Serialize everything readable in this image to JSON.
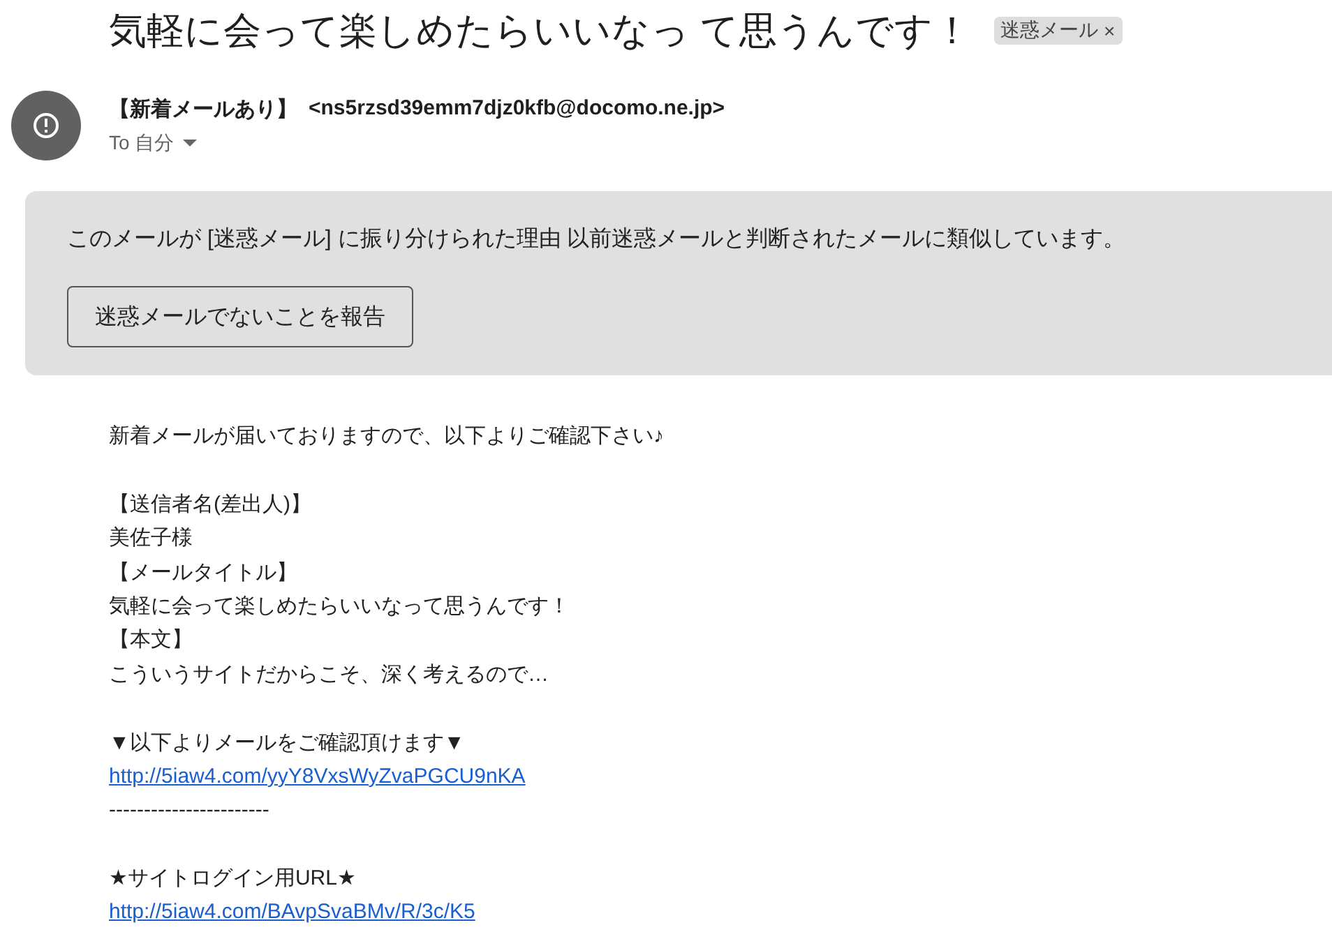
{
  "subject": "気軽に会って楽しめたらいいなっ て思うんです！",
  "label": {
    "text": "迷惑メール",
    "close": "×"
  },
  "sender": {
    "name": "【新着メールあり】",
    "address": "<ns5rzsd39emm7djz0kfb@docomo.ne.jp>",
    "recipient": "To 自分"
  },
  "spam_banner": {
    "message": "このメールが [迷惑メール] に振り分けられた理由 以前迷惑メールと判断されたメールに類似しています。",
    "button": "迷惑メールでないことを報告"
  },
  "body": [
    {
      "kind": "text",
      "text": "新着メールが届いておりますので、以下よりご確認下さい♪"
    },
    {
      "kind": "blank"
    },
    {
      "kind": "text",
      "text": "【送信者名(差出人)】"
    },
    {
      "kind": "text",
      "text": "美佐子様"
    },
    {
      "kind": "text",
      "text": "【メールタイトル】"
    },
    {
      "kind": "text",
      "text": "気軽に会って楽しめたらいいなって思うんです！"
    },
    {
      "kind": "text",
      "text": "【本文】"
    },
    {
      "kind": "text",
      "text": "こういうサイトだからこそ、深く考えるので…"
    },
    {
      "kind": "blank"
    },
    {
      "kind": "text",
      "text": "▼以下よりメールをご確認頂けます▼"
    },
    {
      "kind": "link",
      "text": "http://5iaw4.com/yyY8VxsWyZvaPGCU9nKA"
    },
    {
      "kind": "text",
      "text": "-----------------------"
    },
    {
      "kind": "blank"
    },
    {
      "kind": "text",
      "text": "★サイトログイン用URL★"
    },
    {
      "kind": "link",
      "text": "http://5iaw4.com/BAvpSvaBMv/R/3c/K5"
    }
  ]
}
